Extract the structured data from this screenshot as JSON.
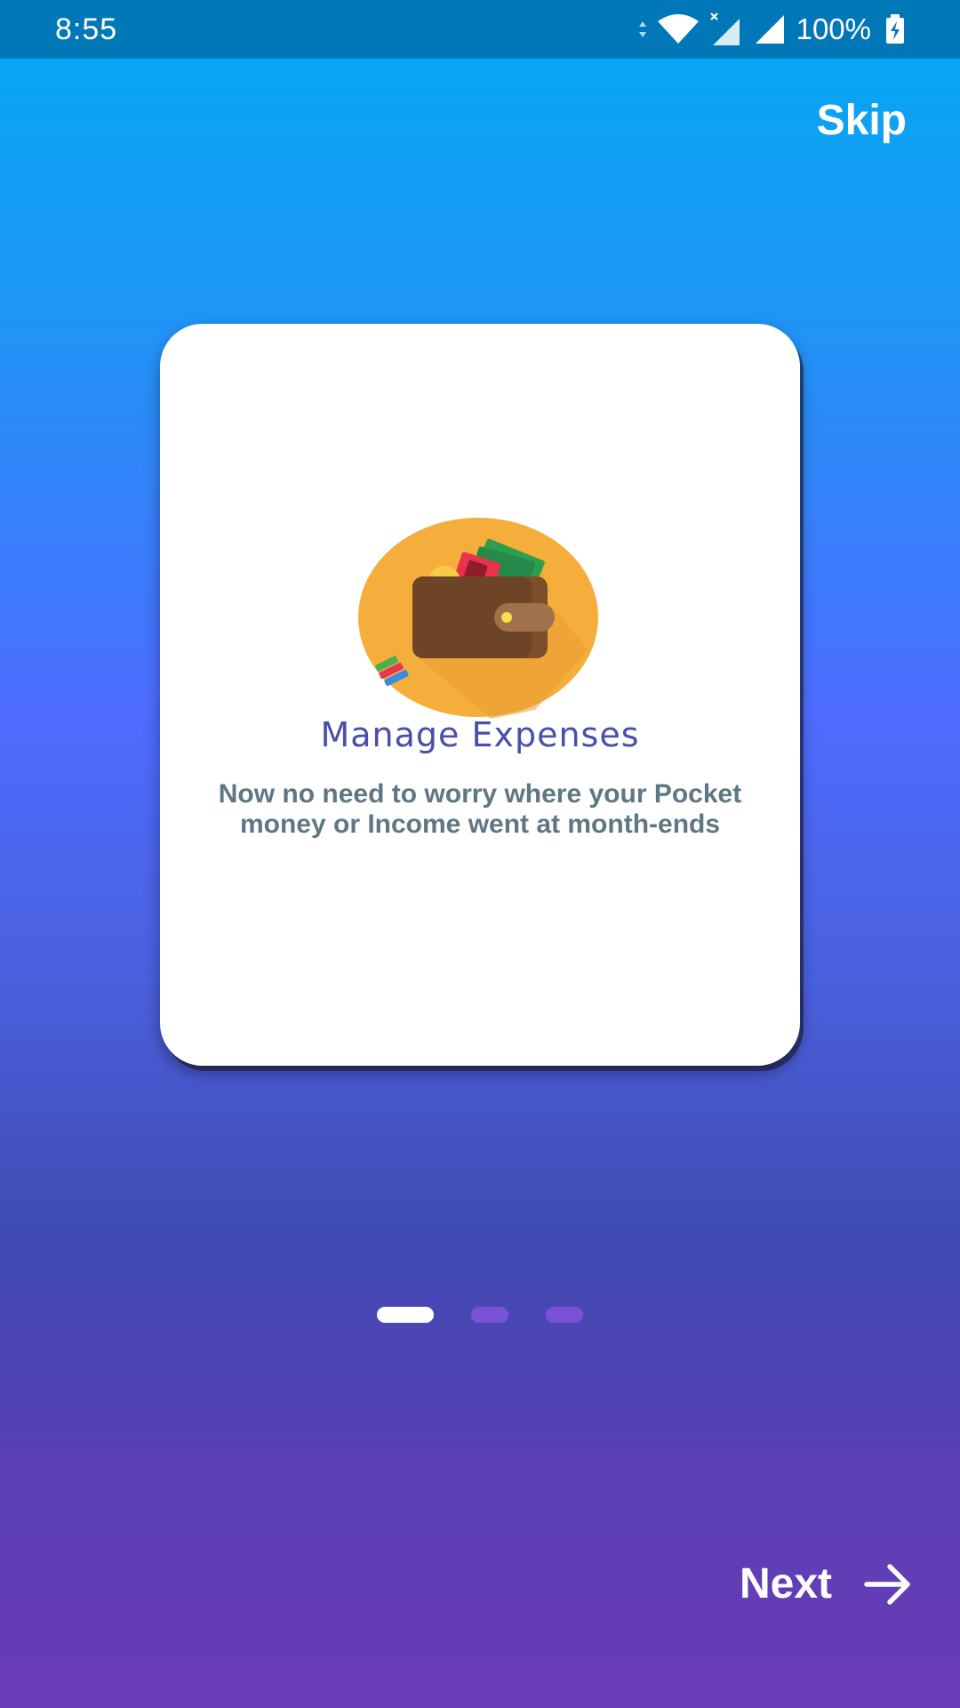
{
  "status_bar": {
    "time": "8:55",
    "battery_percent": "100%",
    "icons": [
      "data-arrows-icon",
      "wifi-icon",
      "cell-signal-no-data-icon",
      "cell-signal-icon",
      "battery-charging-icon"
    ]
  },
  "onboarding": {
    "skip_label": "Skip",
    "next_label": "Next",
    "next_icon": "arrow-right-icon",
    "page_index": 1,
    "page_count": 3
  },
  "card": {
    "illustration_icon": "wallet-icon",
    "title": "Manage Expenses",
    "body": "Now no need to worry where your Pocket money or Income went at month-ends"
  },
  "colors": {
    "status_bar": "#0077b6",
    "gradient_top": "#02a9f3",
    "gradient_bottom": "#6a3bb7",
    "title": "#4a4ea8",
    "body_text": "#5f7784",
    "dot_inactive": "#7a52d8"
  }
}
